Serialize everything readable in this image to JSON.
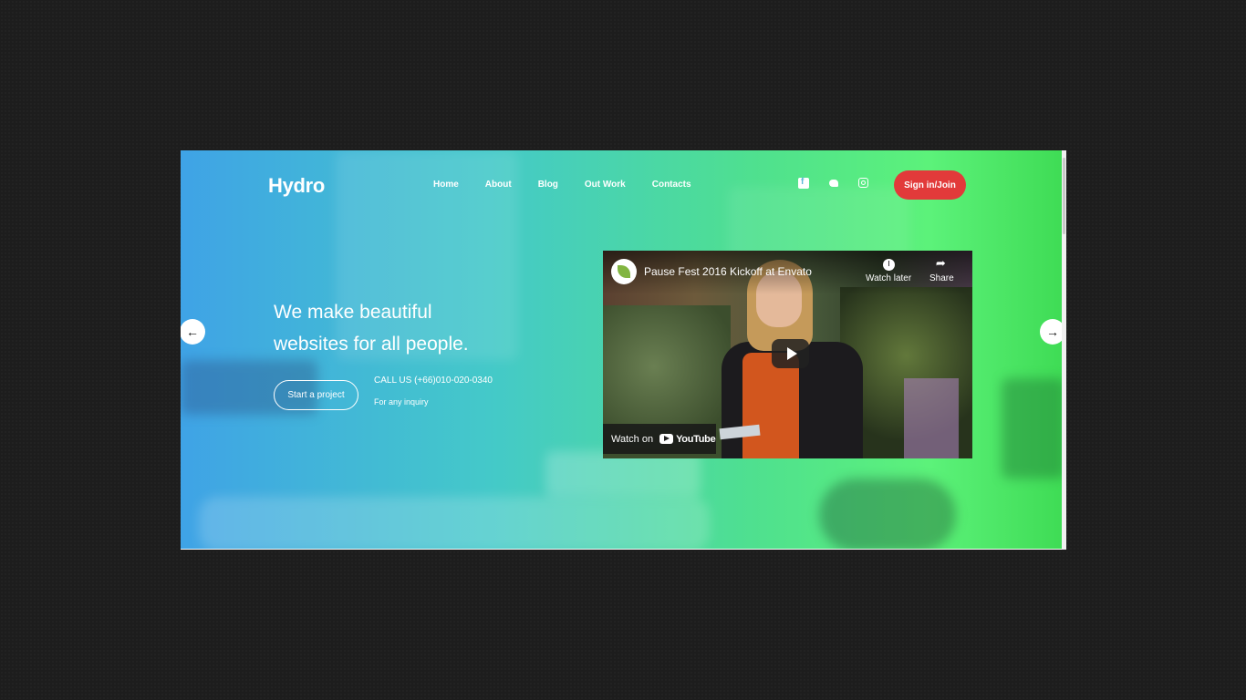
{
  "brand": {
    "logo": "Hydro"
  },
  "nav": {
    "items": [
      "Home",
      "About",
      "Blog",
      "Out Work",
      "Contacts"
    ]
  },
  "social": {
    "icons": [
      "facebook-icon",
      "twitter-icon",
      "instagram-icon"
    ]
  },
  "header": {
    "signin_label": "Sign in/Join"
  },
  "hero": {
    "headline_line1": "We make beautiful",
    "headline_line2": "websites for all people.",
    "cta_label": "Start a project",
    "call_text": "CALL US (+66)010-020-0340",
    "inquiry_text": "For any inquiry"
  },
  "video": {
    "title": "Pause Fest 2016 Kickoff at Envato",
    "watch_later": "Watch later",
    "share": "Share",
    "watch_on": "Watch on",
    "platform": "YouTube"
  },
  "colors": {
    "gradient_start": "#3fa3e6",
    "gradient_end": "#3fdc55",
    "signin_bg": "#e23a3a"
  }
}
